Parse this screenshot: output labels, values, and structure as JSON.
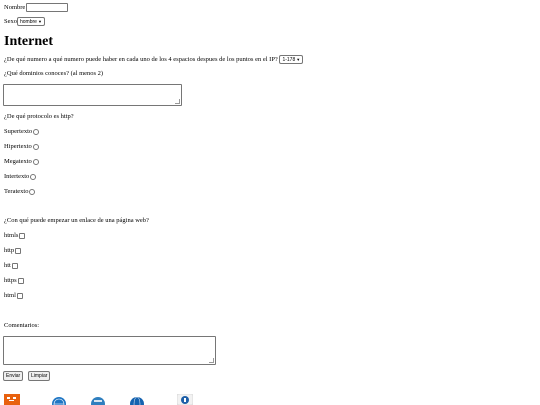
{
  "form": {
    "name_label": "Nombre",
    "sex_label": "Sexo",
    "sex_selected": "hombre",
    "title": "Internet",
    "q_ip": "¿De qué numero a qué numero puede haber en cada uno de los 4 espacios despues de los puntos en el IP?",
    "q_ip_selected": "1-178",
    "q_domains": "¿Qué dominios conoces? (al menos 2)",
    "q_http": "¿De qué protocolo es http?",
    "http_options": [
      "Supertexto",
      "Hipertexto",
      "Megatexto",
      "Intertexto",
      "Teratexto"
    ],
    "q_link": "¿Con qué puede empezar un enlace de una página web?",
    "link_options": [
      "htmls",
      "http",
      "htt",
      "https",
      "html"
    ],
    "comments_label": "Comentarios:",
    "submit_label": "Enviar",
    "reset_label": "Limpiar"
  },
  "badges": {
    "colors": [
      "#e8610e",
      "#1f76c4",
      "#2f7fbf",
      "#1563b0",
      "#1d5fa8"
    ]
  }
}
